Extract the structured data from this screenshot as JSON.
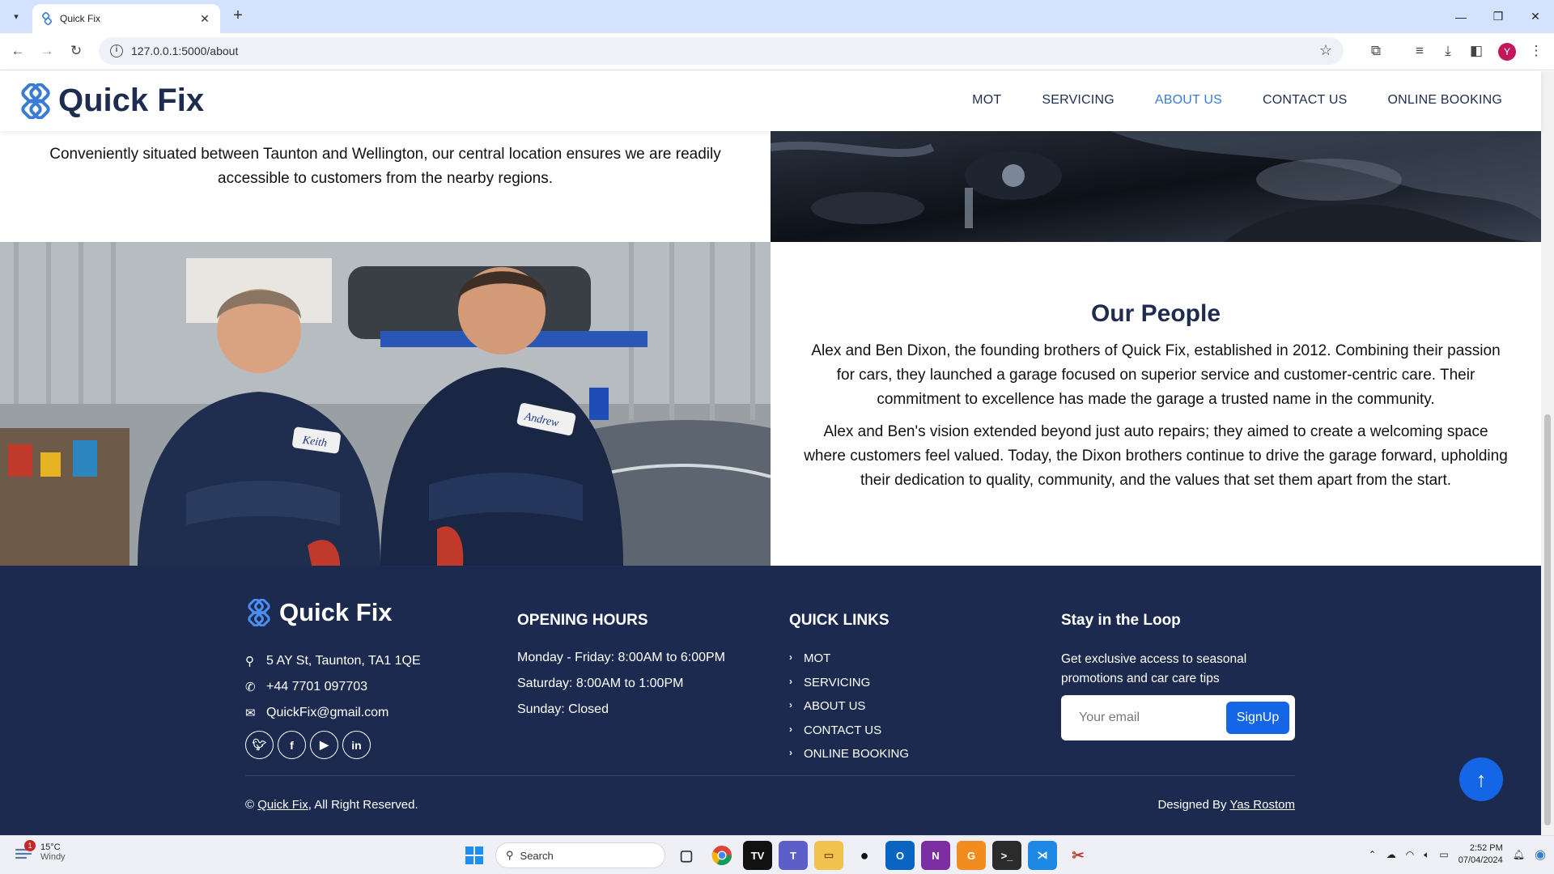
{
  "browser": {
    "tab_title": "Quick Fix",
    "url": "127.0.0.1:5000/about",
    "avatar_letter": "Y"
  },
  "nav": {
    "brand": "Quick Fix",
    "links": [
      "MOT",
      "SERVICING",
      "ABOUT US",
      "CONTACT US",
      "ONLINE BOOKING"
    ],
    "active": "ABOUT US"
  },
  "location": {
    "text": "Conveniently situated between Taunton and Wellington, our central location ensures we are readily accessible to customers from the nearby regions."
  },
  "people": {
    "heading": "Our People",
    "paragraph1": "Alex and Ben Dixon, the founding brothers of Quick Fix, established in 2012. Combining their passion for cars, they launched a garage focused on superior service and customer-centric care. Their commitment to excellence has made the garage a trusted name in the community.",
    "paragraph2": "Alex and Ben's vision extended beyond just auto repairs; they aimed to create a welcoming space where customers feel valued. Today, the Dixon brothers continue to drive the garage forward, upholding their dedication to quality, community, and the values that set them apart from the start.",
    "badge_left": "Keith",
    "badge_right": "Andrew"
  },
  "footer": {
    "brand": "Quick Fix",
    "address": "5 AY St, Taunton, TA1 1QE",
    "phone": "+44 7701 097703",
    "email": "QuickFix@gmail.com",
    "opening_title": "OPENING HOURS",
    "hours": [
      "Monday - Friday: 8:00AM to 6:00PM",
      "Saturday: 8:00AM to 1:00PM",
      "Sunday: Closed"
    ],
    "quick_title": "QUICK LINKS",
    "quick_links": [
      "MOT",
      "SERVICING",
      "ABOUT US",
      "CONTACT US",
      "ONLINE BOOKING"
    ],
    "loop_title": "Stay in the Loop",
    "loop_desc": "Get exclusive access to seasonal promotions and car care tips",
    "email_placeholder": "Your email",
    "signup_label": "SignUp",
    "copyright_prefix": "©",
    "copyright_link": "Quick Fix",
    "copyright_suffix": ", All Right Reserved.",
    "designed_prefix": "Designed By",
    "designed_link": "Yas Rostom"
  },
  "taskbar": {
    "temp": "15°C",
    "weather": "Windy",
    "weather_badge": "1",
    "search_label": "Search",
    "time": "2:52 PM",
    "date": "07/04/2024"
  },
  "colors": {
    "navy": "#1b2a4e",
    "accent": "#1466e6",
    "active_link": "#3a7bd5"
  }
}
